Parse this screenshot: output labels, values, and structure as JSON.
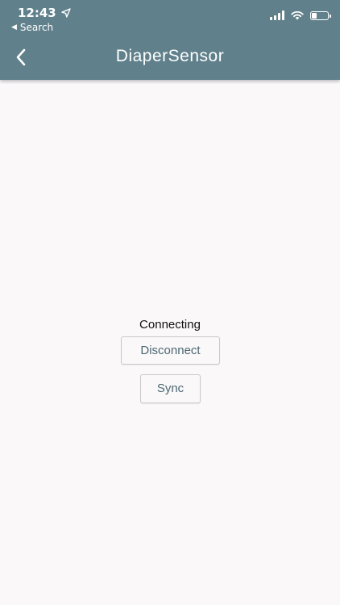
{
  "status_bar": {
    "time": "12:43",
    "back_label": "Search",
    "battery_level": 0.35
  },
  "nav": {
    "title": "DiaperSensor"
  },
  "main": {
    "status": "Connecting",
    "disconnect_label": "Disconnect",
    "sync_label": "Sync"
  },
  "colors": {
    "header": "#60808b",
    "background": "#faf8f9",
    "button_text": "#4d6873"
  }
}
